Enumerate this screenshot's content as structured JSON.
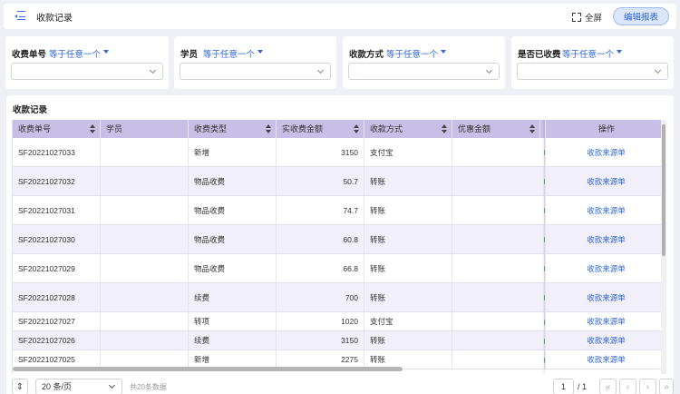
{
  "header": {
    "title": "收款记录",
    "fullscreen_label": "全屏",
    "edit_report_label": "编辑报表"
  },
  "filters": [
    {
      "label": "收费单号",
      "operator": "等于任意一个"
    },
    {
      "label": "学员",
      "operator": "等于任意一个"
    },
    {
      "label": "收款方式",
      "operator": "等于任意一个"
    },
    {
      "label": "是否已收费",
      "operator": "等于任意一个"
    }
  ],
  "table": {
    "title": "收款记录",
    "columns": [
      "收费单号",
      "学员",
      "收费类型",
      "实收费金额",
      "收款方式",
      "优惠金额",
      "操作"
    ],
    "action_label": "收款来源单",
    "rows": [
      {
        "no": "SF20221027033",
        "student": "",
        "type": "新增",
        "amount": "3150",
        "method": "支付宝",
        "discount": ""
      },
      {
        "no": "SF20221027032",
        "student": "",
        "type": "物品收费",
        "amount": "50.7",
        "method": "转账",
        "discount": ""
      },
      {
        "no": "SF20221027031",
        "student": "",
        "type": "物品收费",
        "amount": "74.7",
        "method": "转账",
        "discount": ""
      },
      {
        "no": "SF20221027030",
        "student": "",
        "type": "物品收费",
        "amount": "60.8",
        "method": "转账",
        "discount": ""
      },
      {
        "no": "SF20221027029",
        "student": "",
        "type": "物品收费",
        "amount": "66.8",
        "method": "转账",
        "discount": ""
      },
      {
        "no": "SF20221027028",
        "student": "",
        "type": "续费",
        "amount": "700",
        "method": "转账",
        "discount": ""
      },
      {
        "no": "SF20221027027",
        "student": "",
        "type": "转项",
        "amount": "1020",
        "method": "支付宝",
        "discount": ""
      },
      {
        "no": "SF20221027026",
        "student": "",
        "type": "续费",
        "amount": "3150",
        "method": "转账",
        "discount": ""
      },
      {
        "no": "SF20221027025",
        "student": "",
        "type": "新增",
        "amount": "2275",
        "method": "转账",
        "discount": ""
      }
    ]
  },
  "pagination": {
    "page_size": "20 条/页",
    "total": "共20条数据",
    "current_page": "1",
    "total_pages": "/ 1"
  },
  "colors": {
    "accent": "#3166d4",
    "header_bg": "#c7bfe6",
    "stripe_bg": "#f1eff9"
  }
}
